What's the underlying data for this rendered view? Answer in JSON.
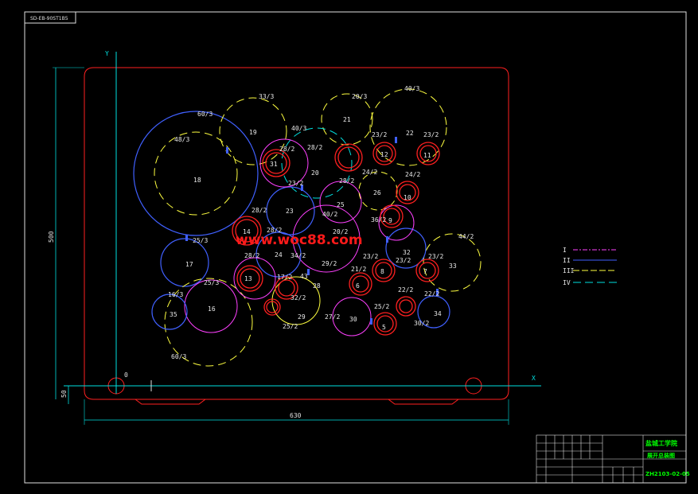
{
  "header_tag": "SD-EB-90ST1B5",
  "axis": {
    "y": "Y",
    "x": "X",
    "origin": "0"
  },
  "dimensions": {
    "height": "500",
    "width": "630",
    "offset": "50"
  },
  "watermark": "www.woc88.com",
  "legend": {
    "items": [
      {
        "label": "I",
        "color": "#ff40ff"
      },
      {
        "label": "II",
        "color": "#4060ff"
      },
      {
        "label": "III",
        "color": "#ffff40"
      },
      {
        "label": "IV",
        "color": "#00e0e0"
      }
    ]
  },
  "title_block": {
    "school": "盐城工学院",
    "drawing_name": "展开总装图",
    "drawing_no": "ZH2103-02-05"
  },
  "gears": [
    {
      "id": "18",
      "ring": "60/3",
      "ring2": "48/3"
    },
    {
      "id": "19",
      "ring": "33/3"
    },
    {
      "id": "21",
      "ring": "20/3"
    },
    {
      "id": "22",
      "ring": "40/3"
    },
    {
      "id": "20",
      "ring": "40/3"
    },
    {
      "id": "31",
      "ring": "28/2"
    },
    {
      "id": "12",
      "ring": "23/2"
    },
    {
      "id": "11",
      "ring": "23/2"
    },
    {
      "id": "26",
      "ring": "24/2"
    },
    {
      "id": "10",
      "ring": "24/2"
    },
    {
      "id": "25",
      "ring": "28/2"
    },
    {
      "id": "23",
      "ring": "28/2"
    },
    {
      "id": "14",
      "ring": "28/2"
    },
    {
      "id": "17",
      "ring": "25/3"
    },
    {
      "id": "13",
      "ring": "28/2"
    },
    {
      "id": "24",
      "ring": "28/2"
    },
    {
      "id": "16",
      "ring": "25/3"
    },
    {
      "id": "35",
      "ring": "16/3"
    },
    {
      "id": "32",
      "ring": "23/2"
    },
    {
      "id": "33",
      "ring": "44/2"
    },
    {
      "id": "8",
      "ring": "23/2"
    },
    {
      "id": "7",
      "ring": "23/2"
    },
    {
      "id": "6",
      "ring": "21/2"
    },
    {
      "id": "29",
      "ring": "28"
    },
    {
      "id": "30",
      "ring": "27/2"
    },
    {
      "id": "5",
      "ring": "25/2"
    },
    {
      "id": "34",
      "ring": "22/2"
    },
    {
      "id": "9",
      "ring": "22/2"
    }
  ],
  "misc_labels": [
    "60/3",
    "25/2",
    "30/2",
    "23/2",
    "17/2",
    "29/2",
    "34/2",
    "40/2",
    "36/2",
    "32/2",
    "20/2",
    "43"
  ]
}
